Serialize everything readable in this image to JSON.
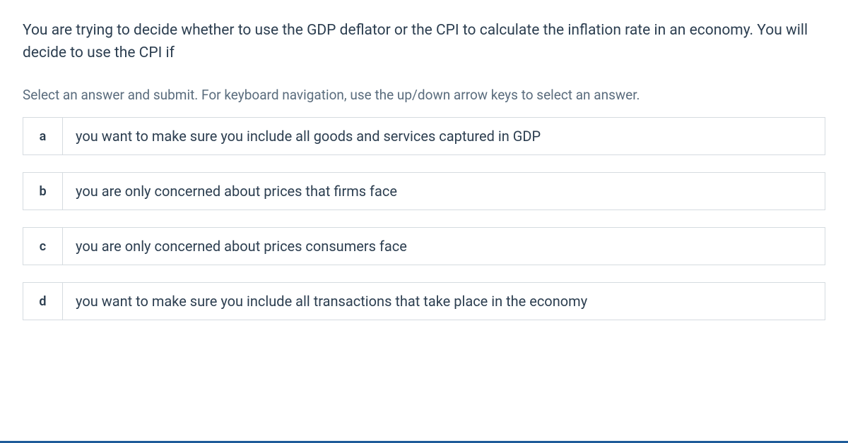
{
  "question": "You are trying to decide whether to use the GDP deflator or the CPI to calculate the inflation rate in an economy. You will decide to use the CPI if",
  "instruction": "Select an answer and submit. For keyboard navigation, use the up/down arrow keys to select an answer.",
  "options": [
    {
      "letter": "a",
      "text": "you want to make sure you include all goods and services captured in GDP"
    },
    {
      "letter": "b",
      "text": "you are only concerned about prices that firms face"
    },
    {
      "letter": "c",
      "text": "you are only concerned about prices consumers face"
    },
    {
      "letter": "d",
      "text": "you want to make sure you include all transactions that take place in the economy"
    }
  ]
}
